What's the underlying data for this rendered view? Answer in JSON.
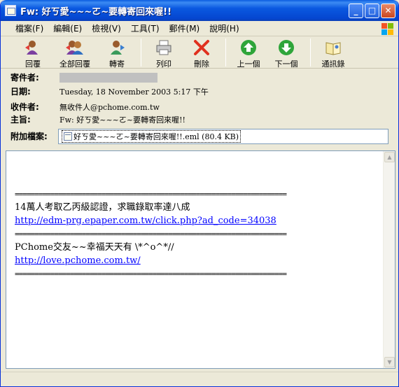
{
  "window": {
    "title": "Fw: 好ㄎ愛~~~ㄛ~要轉寄回來喔!!"
  },
  "menu": {
    "items": [
      "檔案(F)",
      "編輯(E)",
      "檢視(V)",
      "工具(T)",
      "郵件(M)",
      "說明(H)"
    ]
  },
  "toolbar": {
    "reply": "回覆",
    "reply_all": "全部回覆",
    "forward": "轉寄",
    "print": "列印",
    "delete": "刪除",
    "previous": "上一個",
    "next": "下一個",
    "contacts": "通訊錄"
  },
  "headers": {
    "from_label": "寄件者:",
    "date_label": "日期:",
    "date_value": "Tuesday, 18 November 2003 5:17 下午",
    "to_label": "收件者:",
    "to_value": "無收件人@pchome.com.tw",
    "subject_label": "主旨:",
    "subject_value": "Fw: 好ㄎ愛~~~ㄛ~要轉寄回來喔!!",
    "attach_label": "附加檔案:",
    "attach_value": "好ㄎ愛~~~ㄛ~要轉寄回來喔!!.eml (80.4 KB)"
  },
  "body": {
    "separator": "=====================================================================",
    "line1": "14萬人考取乙丙級認證，求職錄取率達八成",
    "link1": "http://edm-prg.epaper.com.tw/click.php?ad_code=34038",
    "line2": "PChome交友~~幸福天天有 \\*^o^*//",
    "link2": "http://love.pchome.com.tw/"
  },
  "icons": {
    "title": "mail-icon",
    "close_button_color": "#c9461f",
    "titlebar_color": "#0a58e0",
    "link_color": "#0000ff"
  }
}
